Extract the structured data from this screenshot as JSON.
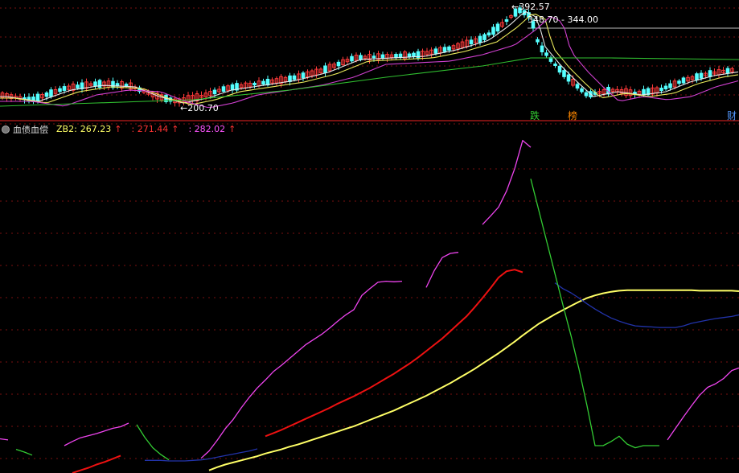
{
  "colors": {
    "background": "#000000",
    "grid": "#7a1010",
    "separator": "#a01818",
    "candle_up": "#ff3a3a",
    "candle_down": "#55ffff",
    "ma_white": "#e8e8e8",
    "ma_yellow": "#e8e85a",
    "ma_magenta": "#d040d0",
    "ma_green": "#30c030",
    "zb1": "#ffff66",
    "zb2_red": "#ee1111",
    "zb2_blue": "#2233aa",
    "zb3_magenta": "#ee44ee",
    "zb3_green": "#33cc33"
  },
  "price_panel": {
    "high_label": "392.57",
    "low_label": "200.70",
    "ref_label": "348.70 - 344.00",
    "markers": [
      {
        "text": "跌",
        "color": "#33cc33"
      },
      {
        "text": "榜",
        "color": "#ff8800"
      },
      {
        "text": "财",
        "color": "#5599ff"
      }
    ]
  },
  "indicator_panel": {
    "name": "血债血偿",
    "zb_label": "ZB2:",
    "values": [
      {
        "text": "267.23",
        "color": "#ffff66"
      },
      {
        "text": "271.44",
        "color": "#ff3333"
      },
      {
        "text": "282.02",
        "color": "#ff55ff"
      }
    ],
    "arrow_icon": "↑"
  },
  "chart_data": {
    "type": "line",
    "x": [
      0,
      10,
      20,
      30,
      40,
      50,
      60,
      70,
      80,
      90,
      100,
      110,
      120,
      130,
      140,
      150,
      160,
      170,
      180,
      190,
      200,
      210,
      220,
      230,
      240,
      250,
      260,
      270,
      280,
      290,
      300,
      310,
      320,
      330,
      340,
      350,
      360,
      370,
      380,
      390,
      400,
      410,
      420,
      430,
      440,
      450,
      460,
      470,
      480,
      490,
      500,
      510,
      520,
      530,
      540,
      550,
      560,
      570,
      580,
      590,
      600,
      610,
      620,
      630,
      640,
      650,
      660,
      670,
      680,
      690,
      700,
      710,
      720,
      730,
      740,
      750,
      760,
      770,
      780,
      790,
      800,
      810,
      820,
      830,
      840,
      850,
      860,
      870,
      880,
      890,
      900,
      910,
      919
    ],
    "series": [
      {
        "name": "ZB1",
        "color": "#ffff66",
        "values": [
          null,
          null,
          null,
          null,
          null,
          null,
          null,
          null,
          null,
          null,
          null,
          null,
          null,
          null,
          null,
          null,
          null,
          null,
          null,
          null,
          null,
          null,
          null,
          null,
          null,
          null,
          5,
          11,
          16,
          20,
          24,
          28,
          32,
          37,
          41,
          45,
          50,
          54,
          59,
          64,
          69,
          74,
          79,
          84,
          89,
          95,
          101,
          107,
          113,
          119,
          126,
          133,
          140,
          147,
          155,
          163,
          171,
          180,
          189,
          198,
          208,
          218,
          228,
          239,
          250,
          262,
          273,
          284,
          293,
          302,
          310,
          318,
          326,
          333,
          338,
          342,
          345,
          347,
          348,
          348,
          348,
          348,
          348,
          348,
          348,
          348,
          348,
          347,
          347,
          347,
          347,
          347,
          346
        ]
      },
      {
        "name": "ZB2",
        "color": "#ee1111",
        "values": [
          null,
          null,
          null,
          null,
          null,
          null,
          null,
          null,
          null,
          0,
          5,
          10,
          16,
          21,
          27,
          33,
          null,
          null,
          null,
          null,
          null,
          null,
          null,
          null,
          null,
          null,
          null,
          null,
          null,
          null,
          null,
          null,
          null,
          70,
          76,
          82,
          89,
          96,
          103,
          110,
          117,
          124,
          132,
          139,
          146,
          154,
          162,
          171,
          180,
          189,
          199,
          209,
          220,
          232,
          244,
          256,
          270,
          284,
          298,
          315,
          333,
          352,
          372,
          384,
          387,
          382,
          null,
          null,
          null,
          null,
          null,
          null,
          null,
          null,
          null,
          null,
          null,
          null,
          null,
          null,
          null,
          null,
          null,
          null,
          null,
          null,
          null,
          null,
          null,
          null,
          null,
          null,
          null
        ]
      },
      {
        "name": "ZB2-blue",
        "color": "#2233aa",
        "values": [
          null,
          null,
          null,
          null,
          null,
          null,
          null,
          null,
          null,
          null,
          null,
          null,
          null,
          null,
          null,
          null,
          null,
          null,
          24,
          24,
          24,
          23,
          23,
          23,
          24,
          25,
          27,
          30,
          33,
          36,
          39,
          42,
          46,
          null,
          null,
          null,
          null,
          null,
          null,
          null,
          null,
          null,
          null,
          null,
          null,
          null,
          null,
          null,
          null,
          null,
          null,
          null,
          null,
          null,
          null,
          null,
          null,
          null,
          null,
          null,
          null,
          null,
          null,
          null,
          null,
          null,
          null,
          null,
          null,
          362,
          351,
          343,
          333,
          322,
          312,
          303,
          295,
          289,
          284,
          280,
          279,
          278,
          277,
          277,
          277,
          280,
          285,
          288,
          291,
          294,
          296,
          298,
          301
        ]
      },
      {
        "name": "ZB3",
        "color": "#ee44ee",
        "values": [
          65,
          63,
          null,
          null,
          null,
          null,
          null,
          null,
          52,
          60,
          67,
          71,
          75,
          80,
          85,
          88,
          95,
          null,
          null,
          null,
          null,
          null,
          null,
          null,
          null,
          28,
          42,
          62,
          84,
          102,
          124,
          144,
          162,
          177,
          193,
          205,
          218,
          231,
          244,
          254,
          264,
          276,
          289,
          301,
          311,
          338,
          351,
          363,
          365,
          364,
          365,
          null,
          null,
          353,
          385,
          410,
          418,
          420,
          null,
          null,
          473,
          489,
          506,
          537,
          579,
          633,
          620,
          null,
          null,
          null,
          null,
          null,
          null,
          null,
          null,
          null,
          null,
          null,
          null,
          null,
          null,
          null,
          null,
          63,
          85,
          107,
          128,
          148,
          163,
          170,
          180,
          195,
          200
        ]
      },
      {
        "name": "ZB3-green",
        "color": "#33cc33",
        "values": [
          null,
          null,
          45,
          40,
          34,
          null,
          null,
          null,
          null,
          null,
          null,
          null,
          null,
          null,
          null,
          null,
          null,
          92,
          68,
          48,
          35,
          25,
          null,
          null,
          null,
          null,
          null,
          null,
          null,
          null,
          null,
          null,
          null,
          null,
          null,
          null,
          null,
          null,
          null,
          null,
          null,
          null,
          null,
          null,
          null,
          null,
          null,
          null,
          null,
          null,
          null,
          null,
          null,
          null,
          null,
          null,
          null,
          null,
          null,
          null,
          null,
          null,
          null,
          null,
          null,
          null,
          560,
          500,
          440,
          380,
          320,
          262,
          198,
          128,
          52,
          52,
          60,
          70,
          55,
          48,
          52,
          52,
          52,
          null,
          null,
          null,
          null,
          null,
          null,
          null,
          null,
          null,
          null
        ]
      }
    ],
    "xlabel": "",
    "ylabel": "",
    "ylim": [
      0,
      640
    ],
    "grid": true
  }
}
